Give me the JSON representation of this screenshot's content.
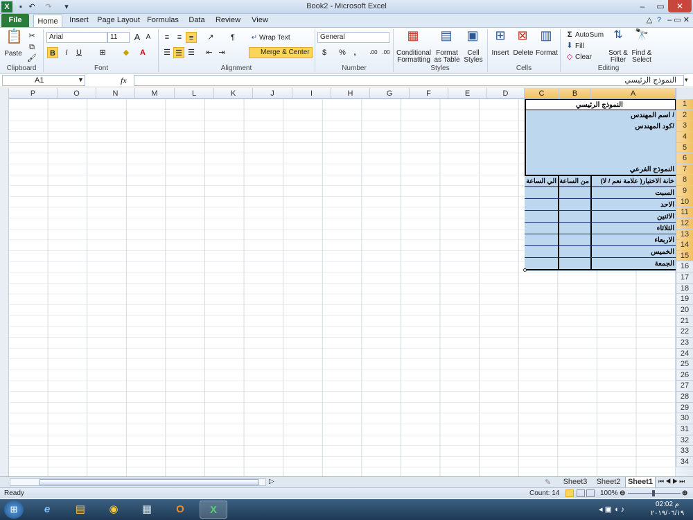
{
  "window": {
    "title": "Book2 - Microsoft Excel",
    "minimize": "–",
    "restore": "▭",
    "close": "✕"
  },
  "qat": {
    "save_icon": "save-icon",
    "undo": "↶",
    "redo": "↷",
    "more": "▾"
  },
  "tabs": [
    {
      "label": "File"
    },
    {
      "label": "Home"
    },
    {
      "label": "Insert"
    },
    {
      "label": "Page Layout"
    },
    {
      "label": "Formulas"
    },
    {
      "label": "Data"
    },
    {
      "label": "Review"
    },
    {
      "label": "View"
    }
  ],
  "ribbon": {
    "clipboard": {
      "paste": "Paste",
      "label": "Clipboard"
    },
    "font": {
      "name": "Arial",
      "size": "11",
      "bold": "B",
      "italic": "I",
      "underline": "U",
      "grow": "A",
      "shrink": "A",
      "label": "Font"
    },
    "alignment": {
      "wrap_text": "Wrap Text",
      "merge_center": "Merge & Center",
      "label": "Alignment"
    },
    "number": {
      "format": "General",
      "percent": "%",
      "comma": ",",
      "inc_dec": ".00",
      "label": "Number"
    },
    "styles": {
      "conditional": "Conditional",
      "conditional2": "Formatting",
      "format_table": "Format",
      "format_table2": "as Table",
      "cell_styles": "Cell",
      "cell_styles2": "Styles",
      "label": "Styles"
    },
    "cells": {
      "insert": "Insert",
      "delete": "Delete",
      "format": "Format",
      "label": "Cells"
    },
    "editing": {
      "autosum": "AutoSum",
      "fill": "Fill",
      "clear": "Clear",
      "sort": "Sort &",
      "sort2": "Filter",
      "find": "Find &",
      "find2": "Select",
      "label": "Editing"
    }
  },
  "formula_bar": {
    "name_box": "A1",
    "fx": "fx",
    "content": "النموذج الرئيسي"
  },
  "columns": [
    "P",
    "O",
    "N",
    "M",
    "L",
    "K",
    "J",
    "I",
    "H",
    "G",
    "F",
    "E",
    "D",
    "C",
    "B",
    "A"
  ],
  "rows": [
    "1",
    "2",
    "3",
    "4",
    "5",
    "6",
    "7",
    "8",
    "9",
    "10",
    "11",
    "12",
    "13",
    "14",
    "15",
    "16",
    "17",
    "18",
    "19",
    "20",
    "21",
    "22",
    "23",
    "24",
    "25",
    "26",
    "27",
    "28",
    "29",
    "30",
    "31",
    "32",
    "33",
    "34"
  ],
  "cells": {
    "A1": "النموذج الرئيسي",
    "A2": "اسم المهندس /",
    "A3": "كود المهندس/",
    "A7": "النموذج الفرعي",
    "A8": "خانة الاختيار( علامة نعم / لا)",
    "B8": "من الساعة",
    "C8": "الي الساعة",
    "days": [
      "السبت",
      "الاحد",
      "الاثنين",
      "الثلاثاء",
      "الاربعاء",
      "الخميس",
      "الجمعة"
    ]
  },
  "sheets": [
    {
      "label": "Sheet3"
    },
    {
      "label": "Sheet2"
    },
    {
      "label": "Sheet1"
    }
  ],
  "status": {
    "ready": "Ready",
    "count": "Count: 14",
    "zoom": "100%"
  },
  "taskbar": {
    "time": "02:02 م",
    "date": "٢٠١٩/٠٦/١٩"
  },
  "colors": {
    "accent": "#2a7d39",
    "selection": "#bdd7ee",
    "header_sel": "#f1c15f"
  }
}
